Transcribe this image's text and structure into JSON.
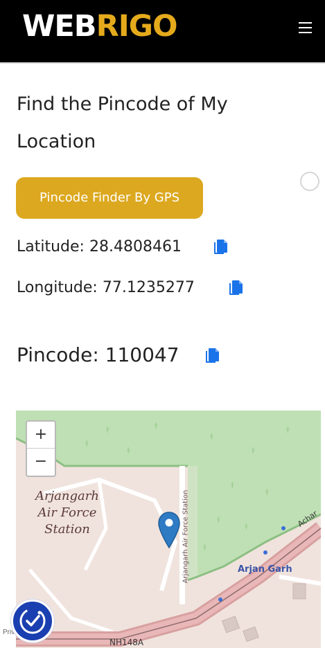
{
  "header": {
    "logo_part1": "WEB",
    "logo_part2": "RIGO",
    "menu_icon": "hamburger-menu-icon",
    "colors": {
      "background": "#000000",
      "logo_accent": "#e5aa1c"
    }
  },
  "main": {
    "title_line1": "Find the Pincode of My",
    "title_line2": "Location",
    "gps_button_label": "Pincode Finder By GPS",
    "latitude_label": "Latitude:",
    "latitude_value": "28.4808461",
    "longitude_label": "Longitude:",
    "longitude_value": "77.1235277",
    "pincode_label": "Pincode:",
    "pincode_value": "110047",
    "copy_icon": "copy-icon",
    "colors": {
      "button": "#dca81f",
      "copy_icon": "#1a73e8"
    }
  },
  "map": {
    "zoom_in_label": "+",
    "zoom_out_label": "−",
    "place_label_line1": "Arjangarh",
    "place_label_line2": "Air Force",
    "place_label_line3": "Station",
    "road_label_vertical": "Arjangarh Air Force Station",
    "locality_label": "Arjan Garh",
    "road_label_highway": "NH148A",
    "road_label_edge": "Achar",
    "marker_icon": "map-marker-icon"
  },
  "footer": {
    "accessibility_icon": "accessibility-icon",
    "privacy_text": "Priv"
  }
}
